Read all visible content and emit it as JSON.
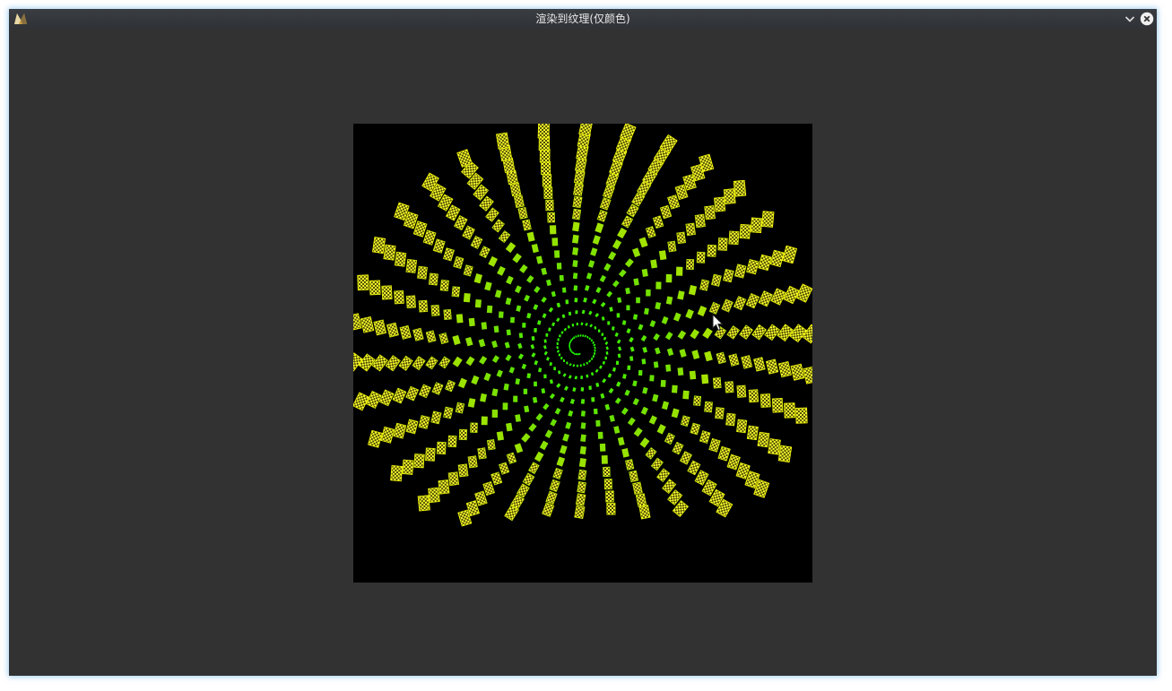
{
  "window": {
    "title": "渲染到纹理(仅颜色)",
    "icons": {
      "app": "app-logo-icon",
      "minimize": "chevron-down-icon",
      "close": "close-circle-icon"
    }
  },
  "viewport": {
    "background": "#000000",
    "spiral_colors": [
      "#1aff00",
      "#66e000",
      "#c8e600",
      "#ffff00"
    ],
    "texture_checker_colors": [
      "#ffff33",
      "#3a3a00"
    ]
  },
  "colors": {
    "window_bg": "#323232",
    "titlebar_bg": "#34373c",
    "title_text": "#e8e8e8",
    "focus_glow": "#50aae6"
  }
}
